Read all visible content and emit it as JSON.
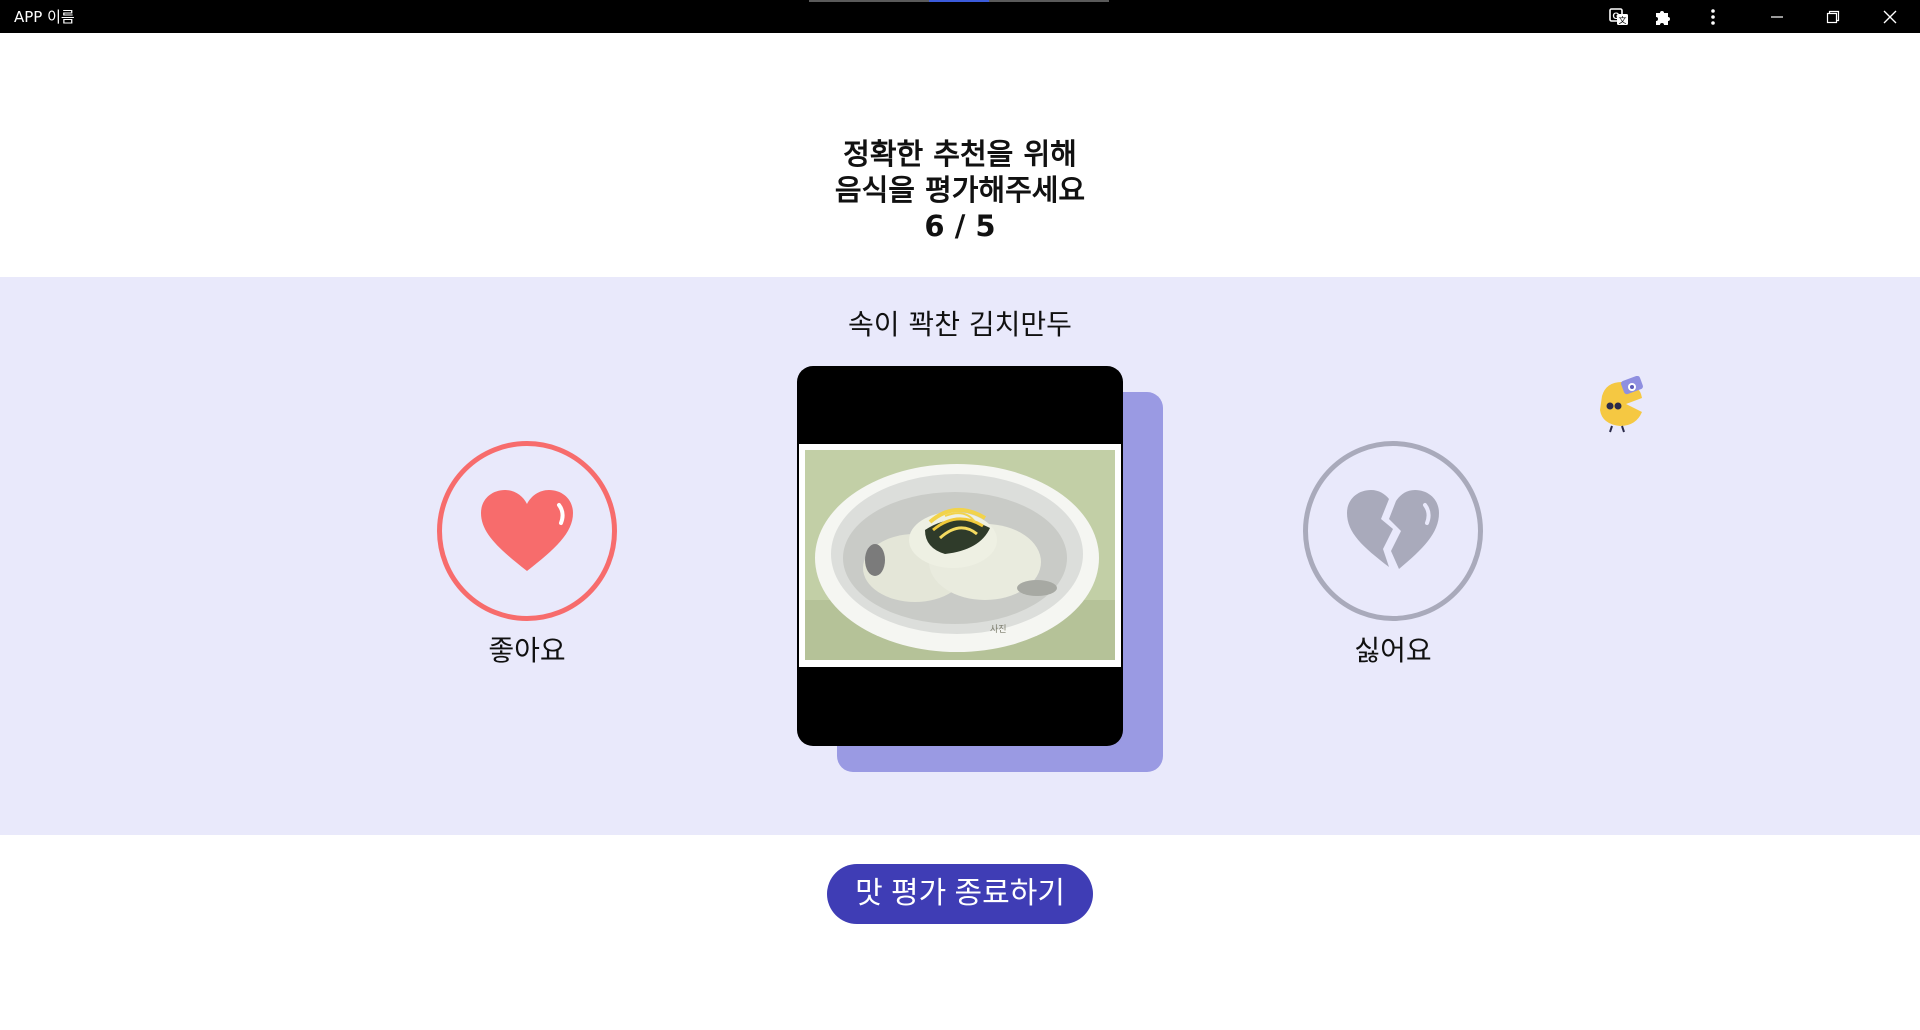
{
  "window": {
    "title": "APP 이름",
    "controls": {
      "translate_icon": "translate-icon",
      "extensions_icon": "puzzle-icon",
      "menu_icon": "kebab-menu-icon",
      "minimize_icon": "minimize-icon",
      "restore_icon": "restore-icon",
      "close_icon": "close-icon"
    }
  },
  "header": {
    "line1": "정확한 추천을 위해",
    "line2": "음식을 평가해주세요",
    "counter": "6 / 5"
  },
  "food": {
    "name": "속이 꽉찬 김치만두",
    "image": "dumpling-soup-photo"
  },
  "actions": {
    "like_label": "좋아요",
    "like_icon": "heart-icon",
    "dislike_label": "싫어요",
    "dislike_icon": "broken-heart-icon",
    "finish_label": "맛 평가 종료하기"
  },
  "colors": {
    "band": "#e9e9fb",
    "like": "#f76c6c",
    "dislike": "#a9aabb",
    "accent": "#3f3db5",
    "card_shadow": "#9a9ae3"
  }
}
